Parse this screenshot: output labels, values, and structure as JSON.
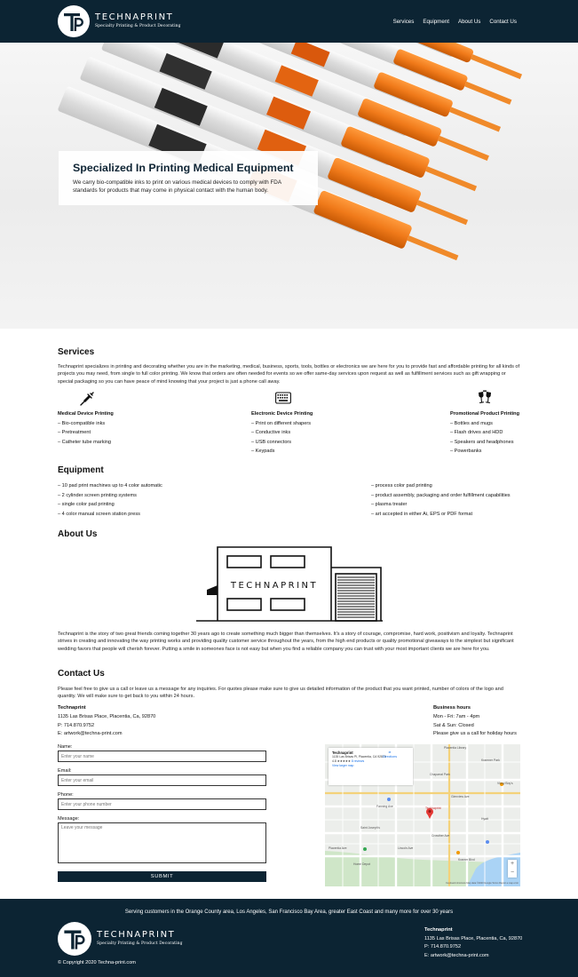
{
  "header": {
    "brand": "TECHNAPRINT",
    "tagline": "Specialty Printing & Product Decorating",
    "nav": [
      "Services",
      "Equipment",
      "About Us",
      "Contact Us"
    ]
  },
  "hero": {
    "title": "Specialized In Printing Medical Equipment",
    "text": "We carry bio-compatible inks to print on various medical devices to comply with FDA standards for products that may come in physical contact with the human body."
  },
  "services": {
    "title": "Services",
    "intro": "Technaprint specializes in printing and decorating whether you are in the marketing, medical, business, sports, tools, bottles or electronics we are here for you to provide fast and affordable printing for all kinds of projects you may need, from single to full color printing. We know that orders are often needed for events so we offer same-day services upon request as well as fulfillment services such as gift wrapping or special packaging so you can have peace of mind knowing that your project is just a phone call away.",
    "columns": [
      {
        "icon": "syringe-icon",
        "title": "Medical Device Printing",
        "items": [
          "– Bio-compatible inks",
          "– Pretreatment",
          "– Catheter tube marking"
        ]
      },
      {
        "icon": "keyboard-icon",
        "title": "Electronic Device Printing",
        "items": [
          "– Print on different shapers",
          "– Conductive inks",
          "– USB connectors",
          "– Keypads"
        ]
      },
      {
        "icon": "champagne-glasses-icon",
        "title": "Promotional Product Printing",
        "items": [
          "– Bottles and mugs",
          "– Flash drives and HDD",
          "– Speakers and headphones",
          "– Powerbanks"
        ]
      }
    ]
  },
  "equipment": {
    "title": "Equipment",
    "left": [
      "– 10 pad print machines up to 4 color automatic",
      "– 2 cylinder screen printing systems",
      "– single color pad printing",
      "– 4 color manual screen station press"
    ],
    "right": [
      "– process color pad printing",
      "– product assembly, packaging and order fulfillment capabilities",
      "– plasma treater",
      "– art accepted in either Ai, EPS or PDF format"
    ]
  },
  "about": {
    "title": "About Us",
    "building_sign": "TECHNAPRINT",
    "text": "Technaprint is the story of two great friends coming together 30 years ago to create something much bigger than themselves. It's a story of courage, compromise, hard work, positivism and loyalty. Technaprint strives in creating and innovating the way printing works and providing quality customer service throughout the years, from the high end products or quality promotional giveaways to the simplest but significant wedding favors that people will cherish forever. Putting a smile in someones face is not easy but when you find a reliable company you can trust with your most important clients we are here for you."
  },
  "contact": {
    "title": "Contact Us",
    "intro": "Please feel free to give us a call or leave us a message for any inquiries. For quotes please make sure to give us detailed information of the product that you want printed, number of colors of the logo and quantity. We will make sure to get back to you within 24 hours.",
    "company": "Technaprint",
    "address": "1135 Las Brisas Place, Placentia, Ca, 92870",
    "phone": "P: 714.870.9752",
    "email": "E: artwork@techna-print.com",
    "hours_title": "Business hours",
    "hours": [
      "Mon - Fri: 7am - 4pm",
      "Sat & Sun: Closed",
      "Please give us a call for holiday hours"
    ],
    "form": {
      "name_label": "Name:",
      "name_placeholder": "Enter your name",
      "email_label": "Email:",
      "email_placeholder": "Enter your email",
      "phone_label": "Phone:",
      "phone_placeholder": "Enter your phone number",
      "message_label": "Message:",
      "message_placeholder": "Leave your message",
      "submit": "SUBMIT"
    },
    "map": {
      "place": "Technaprint",
      "place_address": "1135 Las Brisas Pl, Placentia, CA 92870",
      "rating": "4.8 ★★★★★",
      "reviews": "8 reviews",
      "larger_map": "View larger map",
      "directions": "Directions",
      "pin_label": "Technaprint",
      "labels": [
        "Placentia Library",
        "Kraemer Park",
        "Chaparral Park",
        "Fanning Ave",
        "Glenview Ave",
        "Vinny Boy's",
        "Saint Joseph's",
        "Hyatt",
        "Crowther Ave",
        "Home Depot",
        "Lincoln Ave",
        "Placentia Ave",
        "Kramer Blvd"
      ],
      "footer": "Keyboard shortcuts   Map data ©2020 Google   Terms   Report a map error"
    }
  },
  "footer": {
    "serving": "Serving customers in the Orange County area, Los Angeles, San Francisco Bay Area, greater East Coast and many more for over 30 years",
    "copyright": "© Copyright 2020 Techna-print.com",
    "company": "Technaprint",
    "address": "1135 Las Brisas Place, Placentia, Ca, 92870",
    "phone": "P: 714.870.9752",
    "email": "E: artwork@techna-print.com"
  },
  "colors": {
    "navy": "#0c2433",
    "orange": "#f07a1a"
  }
}
